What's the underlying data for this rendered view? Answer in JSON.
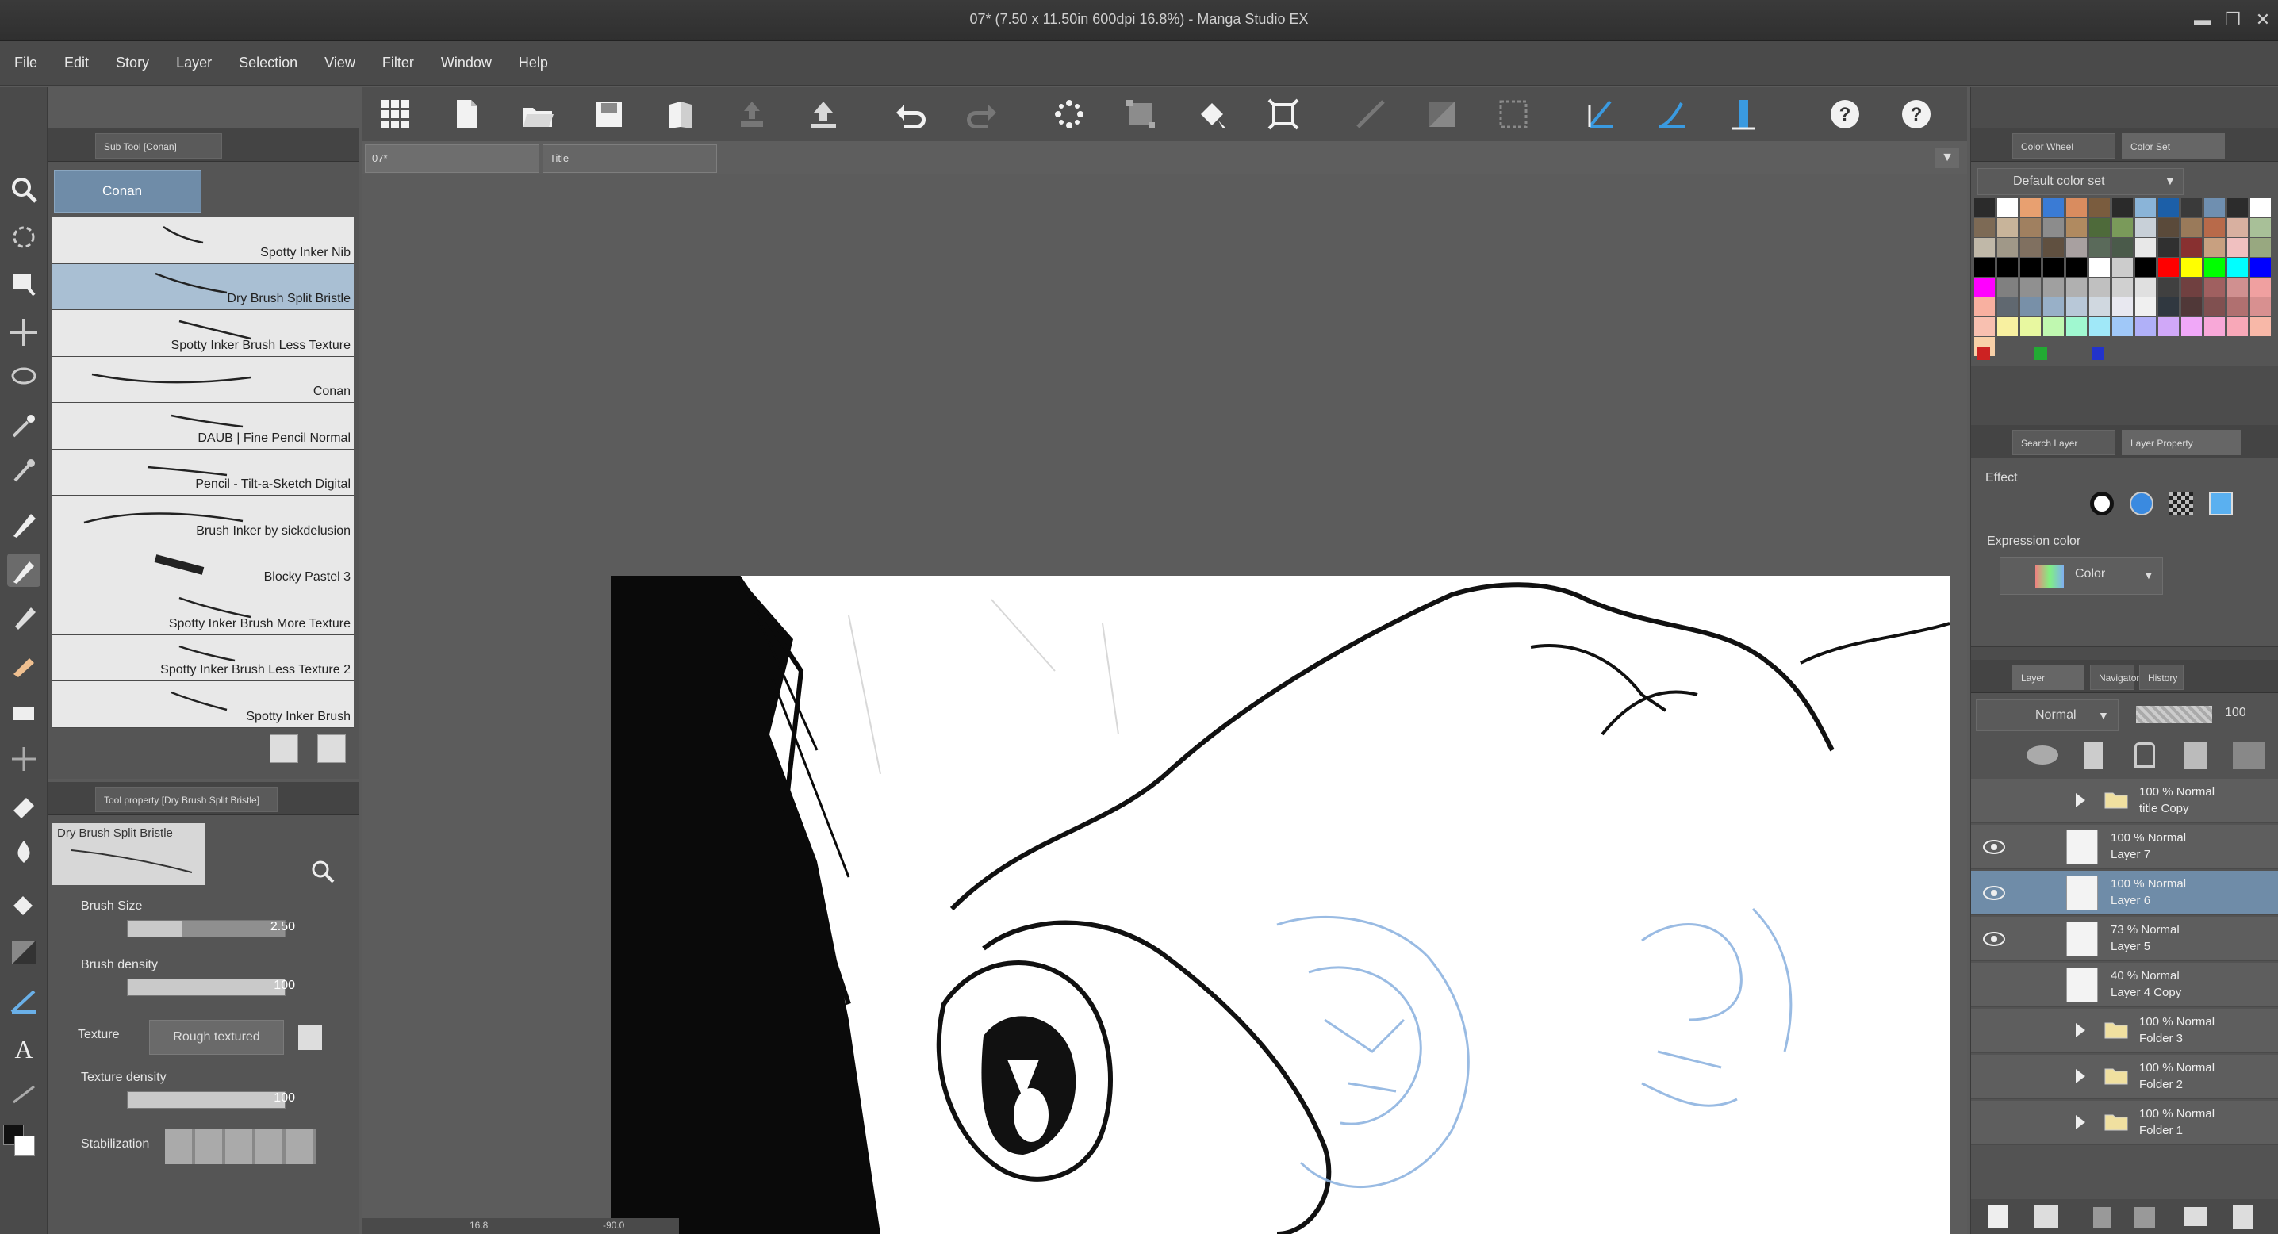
{
  "window": {
    "title": "07* (7.50 x 11.50in 600dpi 16.8%) - Manga Studio EX",
    "controls": [
      "minimize",
      "maximize",
      "close"
    ]
  },
  "menu": [
    "File",
    "Edit",
    "Story",
    "Layer",
    "Selection",
    "View",
    "Filter",
    "Window",
    "Help"
  ],
  "toolbar": {
    "icons": [
      "grid-icon",
      "new-page-icon",
      "open-folder-icon",
      "save-icon",
      "page-icon",
      "export-icon",
      "upload-icon",
      "undo-icon",
      "redo-icon",
      "sparkle-icon",
      "transform-icon",
      "fill-bucket-icon",
      "crop-icon",
      "ruler-off-icon",
      "gradient-icon",
      "selection-icon",
      "pen-ruler-icon",
      "curve-ruler-icon",
      "ruler-icon",
      "help-icon",
      "help-circle-icon"
    ]
  },
  "subtool_panel": {
    "tab_label": "Sub Tool [Conan]",
    "group_label": "Conan",
    "brushes": [
      {
        "name": "Spotty Inker Nib",
        "selected": false
      },
      {
        "name": "Dry Brush Split Bristle",
        "selected": true
      },
      {
        "name": "Spotty Inker Brush Less Texture",
        "selected": false
      },
      {
        "name": "Conan",
        "selected": false
      },
      {
        "name": "DAUB | Fine Pencil Normal",
        "selected": false
      },
      {
        "name": "Pencil - Tilt-a-Sketch Digital",
        "selected": false
      },
      {
        "name": "Brush Inker by sickdelusion",
        "selected": false
      },
      {
        "name": "Blocky Pastel 3",
        "selected": false
      },
      {
        "name": "Spotty Inker Brush More Texture",
        "selected": false
      },
      {
        "name": "Spotty Inker Brush Less Texture 2",
        "selected": false
      },
      {
        "name": "Spotty Inker Brush",
        "selected": false
      }
    ]
  },
  "tool_property": {
    "tab_label": "Tool property [Dry Brush Split Bristle]",
    "preview_label": "Dry Brush Split Bristle",
    "brush_size": {
      "label": "Brush Size",
      "value": "2.50",
      "fraction": 0.35
    },
    "brush_density": {
      "label": "Brush density",
      "value": "100",
      "fraction": 1.0
    },
    "texture": {
      "label": "Texture",
      "value": "Rough textured"
    },
    "texture_density": {
      "label": "Texture density",
      "value": "100",
      "fraction": 1.0
    },
    "stabilization": {
      "label": "Stabilization"
    }
  },
  "document_tabs": [
    "07*",
    "Title"
  ],
  "status_bar": {
    "zoom": "16.8",
    "angle": "-90.0"
  },
  "color_panel": {
    "tabs": [
      "Color Wheel",
      "Color Set"
    ],
    "set_name": "Default color set",
    "swatches": [
      "#2b2b2b",
      "#ffffff",
      "#e8a070",
      "#3a7bd5",
      "#d98c5f",
      "#7a5c3e",
      "#2a2a2a",
      "#8ab4d8",
      "#1c5fa8",
      "#3a3a3a",
      "#6f8fb0",
      "#2c2c2c",
      "#ffffff",
      "#7d6a55",
      "#c8b49a",
      "#a08060",
      "#8c8c8c",
      "#b08a60",
      "#4e6a3a",
      "#7a9a5a",
      "#c8d0d8",
      "#5a4a3a",
      "#9a7a5a",
      "#b86a4a",
      "#d8b0a0",
      "#a8c098",
      "#c0b8a8",
      "#a09888",
      "#807060",
      "#605040",
      "#a8a0a0",
      "#5a6a5a",
      "#4a5a4a",
      "#e8e8e8",
      "#303030",
      "#883030",
      "#c8a080",
      "#f0c0c0",
      "#98a880",
      "#000000",
      "#000000",
      "#000000",
      "#000000",
      "#000000",
      "#ffffff",
      "#cccccc",
      "#000000",
      "#ff0000",
      "#ffff00",
      "#00ff00",
      "#00ffff",
      "#0000ff",
      "#ff00ff",
      "#808080",
      "#909090",
      "#a0a0a0",
      "#b0b0b0",
      "#c0c0c0",
      "#d0d0d0",
      "#e0e0e0",
      "#404040",
      "#704040",
      "#a06060",
      "#d09090",
      "#f0a0a0",
      "#f8b0a0",
      "#606870",
      "#7890a8",
      "#98b0c8",
      "#b8c8d8",
      "#d0d8e0",
      "#e8e8f0",
      "#f0f0f0",
      "#303840",
      "#503838",
      "#805050",
      "#b07070",
      "#d89090",
      "#f8c0b0",
      "#f8f0a0",
      "#e8f8a0",
      "#c0f8b0",
      "#a0f8d0",
      "#a0e8f8",
      "#a0c8f8",
      "#b0b0f8",
      "#d0a8f8",
      "#f0a8f8",
      "#f8a8d8",
      "#f8a8b8",
      "#f8b8a8",
      "#f8d0a8"
    ],
    "rgb": [
      "#cc2222",
      "#22aa33",
      "#2233cc"
    ]
  },
  "layer_property": {
    "tabs": [
      "Search Layer",
      "Layer Property"
    ],
    "effect_label": "Effect",
    "expression_label": "Expression color",
    "expression_value": "Color"
  },
  "layer_panel": {
    "tabs": [
      "Layer",
      "Navigator",
      "History"
    ],
    "blend_mode": "Normal",
    "opacity": "100",
    "layers": [
      {
        "top": "100 % Normal",
        "bottom": "title Copy",
        "folder": true,
        "visible": false,
        "selected": false
      },
      {
        "top": "100 % Normal",
        "bottom": "Layer 7",
        "folder": false,
        "visible": true,
        "selected": false
      },
      {
        "top": "100 % Normal",
        "bottom": "Layer 6",
        "folder": false,
        "visible": true,
        "selected": true
      },
      {
        "top": "73 % Normal",
        "bottom": "Layer 5",
        "folder": false,
        "visible": true,
        "selected": false
      },
      {
        "top": "40 % Normal",
        "bottom": "Layer 4 Copy",
        "folder": false,
        "visible": false,
        "selected": false
      },
      {
        "top": "100 % Normal",
        "bottom": "Folder 3",
        "folder": true,
        "visible": false,
        "selected": false
      },
      {
        "top": "100 % Normal",
        "bottom": "Folder 2",
        "folder": true,
        "visible": false,
        "selected": false
      },
      {
        "top": "100 % Normal",
        "bottom": "Folder 1",
        "folder": true,
        "visible": false,
        "selected": false
      }
    ]
  }
}
